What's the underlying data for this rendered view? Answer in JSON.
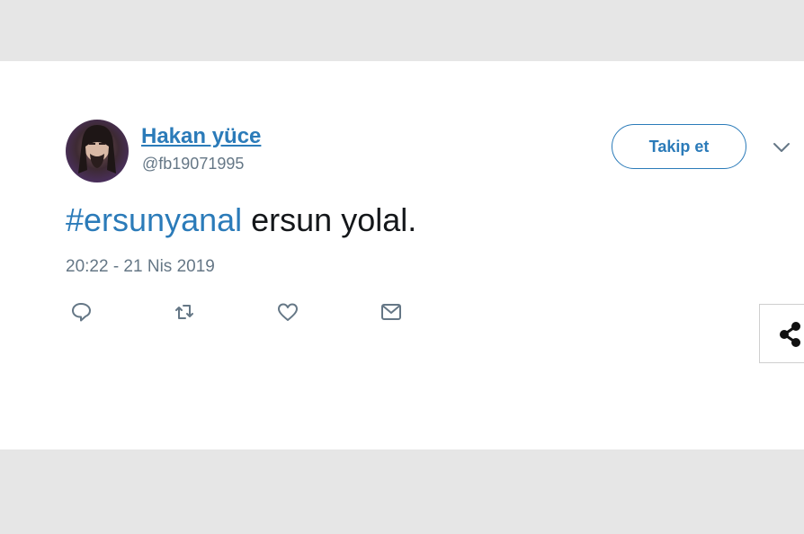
{
  "tweet": {
    "author_name": "Hakan yüce",
    "author_handle": "@fb19071995",
    "follow_label": "Takip et",
    "hashtag": "#ersunyanal",
    "body_text": " ersun yolal.",
    "timestamp": "20:22 - 21 Nis 2019",
    "actions": [
      "reply-icon",
      "retweet-icon",
      "like-icon",
      "message-icon"
    ]
  },
  "share_widget": {
    "icon": "share-icon"
  },
  "colors": {
    "link": "#2b7bb9",
    "muted": "#657786",
    "text": "#14171a",
    "page_background": "#e6e6e6",
    "card_background": "#ffffff"
  }
}
